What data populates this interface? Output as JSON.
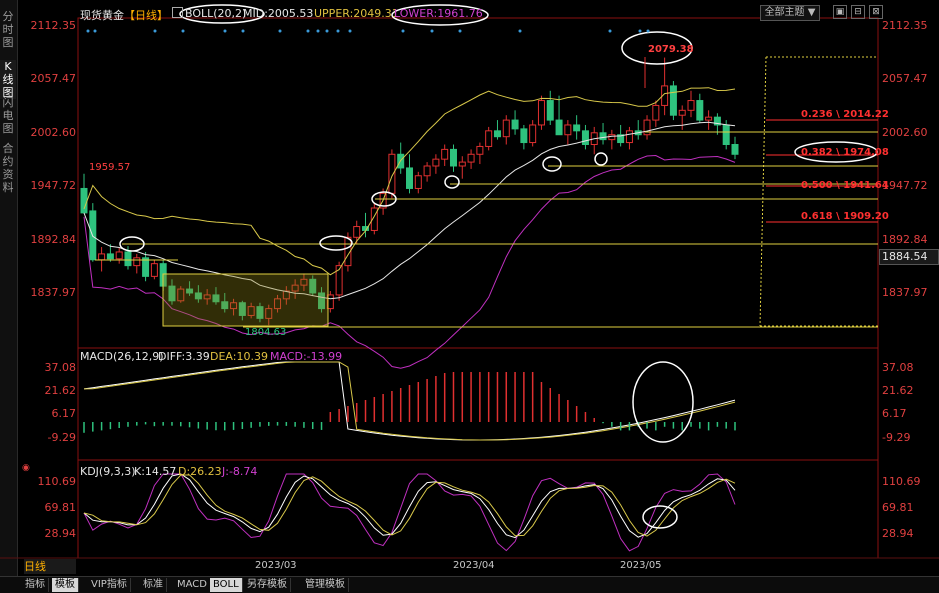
{
  "side_tabs": [
    "分时图",
    "K线图",
    "闪电图",
    "合约资料"
  ],
  "header": {
    "instrument": "现货黄金",
    "period": "【日线】",
    "boll_label": "BOLL(20,2)",
    "mid": "MID:2005.53",
    "upper": "UPPER:2049.31",
    "lower": "LOWER:1961.76",
    "theme_select": "全部主题",
    "win_buttons": [
      "▣",
      "⊟",
      "⊠"
    ]
  },
  "price_axis": [
    "2112.35",
    "2057.47",
    "2002.60",
    "1947.72",
    "1892.84",
    "1837.97"
  ],
  "current_price": "1884.54",
  "annotations": {
    "high": "2079.38",
    "left_high": "1959.57",
    "low": "1804.63"
  },
  "fib_levels": [
    "0.236 \\ 2014.22",
    "0.382 \\ 1974.08",
    "0.500 \\ 1941.64",
    "0.618 \\ 1909.20"
  ],
  "macd": {
    "label": "MACD(26,12,9)",
    "diff": "DIFF:3.39",
    "dea": "DEA:10.39",
    "macd": "MACD:-13.99",
    "axis": [
      "37.08",
      "21.62",
      "6.17",
      "-9.29"
    ]
  },
  "kdj": {
    "label": "KDJ(9,3,3)",
    "k": "K:14.57",
    "d": "D:26.23",
    "j": "J:-8.74",
    "axis": [
      "110.69",
      "69.81",
      "28.94"
    ]
  },
  "period_label": "日线",
  "dates": [
    "2023/03",
    "2023/04",
    "2023/05"
  ],
  "bottom_tabs": [
    "指标",
    "模板",
    "VIP指标",
    "标准",
    "MACD",
    "BOLL",
    "另存模板",
    "管理模板"
  ],
  "bottom_active": [
    "模板",
    "BOLL"
  ],
  "colors": {
    "up": "#e03030",
    "down": "#2ec27e",
    "boll": "#d8c84a",
    "mid": "#e6e6e6",
    "lower": "#c030c0",
    "fib": "#ff3030",
    "support": "#e0d040"
  }
}
